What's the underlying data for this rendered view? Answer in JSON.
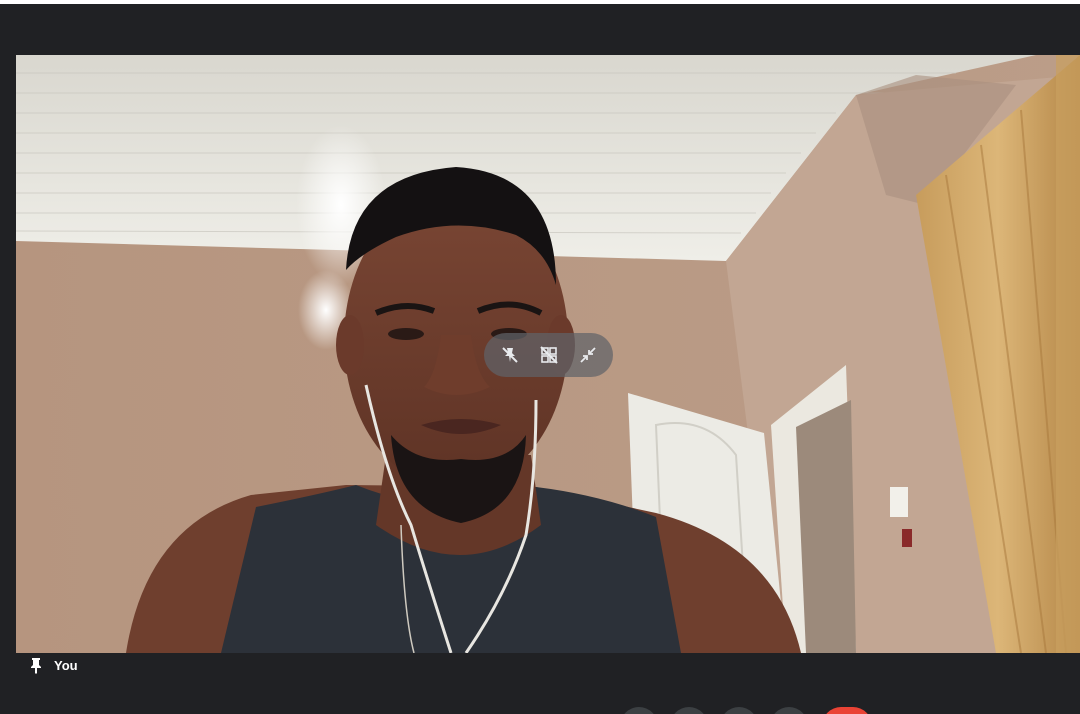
{
  "tile": {
    "participant_name": "You",
    "pin_icon": "pin-icon"
  },
  "overlay": {
    "buttons": [
      {
        "icon": "unpin-icon"
      },
      {
        "icon": "remove-tile-icon"
      },
      {
        "icon": "minimize-icon"
      }
    ]
  },
  "controls": {
    "buttons": [
      {
        "icon": "microphone-icon"
      },
      {
        "icon": "camera-icon"
      },
      {
        "icon": "captions-icon"
      },
      {
        "icon": "present-icon"
      },
      {
        "icon": "end-call-icon"
      }
    ]
  },
  "colors": {
    "background": "#202124",
    "tile_overlay": "#5f6368",
    "end_call": "#ea4335",
    "control_button": "#3c4043"
  }
}
